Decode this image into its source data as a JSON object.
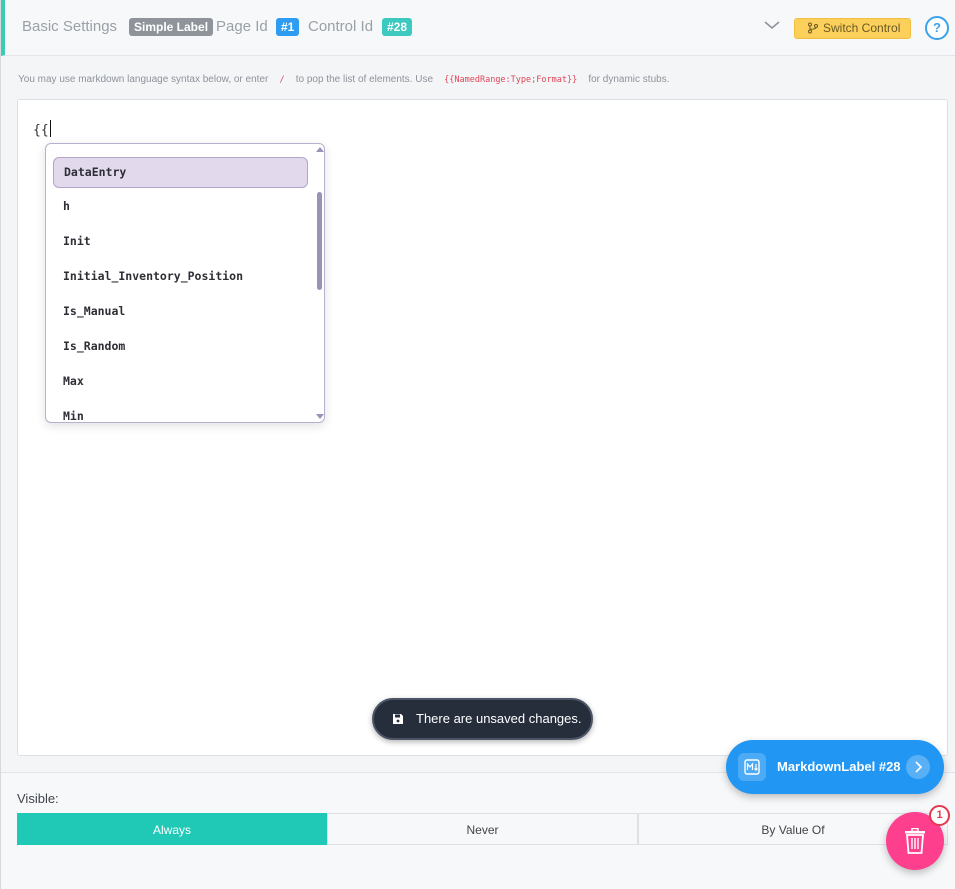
{
  "header": {
    "basic_settings": "Basic Settings",
    "type_badge": "Simple Label",
    "page_id_label": "Page Id",
    "page_id": "#1",
    "control_id_label": "Control Id",
    "control_id": "#28",
    "switch_control": "Switch Control",
    "help": "?"
  },
  "hint": {
    "part1": "You may use markdown language syntax below, or enter",
    "slash": "/",
    "part2": "to pop the list of elements. Use",
    "stub": "{{NamedRange:Type;Format}}",
    "part3": "for dynamic stubs."
  },
  "editor": {
    "value": "{{"
  },
  "dropdown": {
    "items": [
      "DataEntry",
      "h",
      "Init",
      "Initial_Inventory_Position",
      "Is_Manual",
      "Is_Random",
      "Max",
      "Min"
    ],
    "selected_index": 0
  },
  "toast": {
    "message": "There are unsaved changes."
  },
  "visibility": {
    "label": "Visible:",
    "options": [
      "Always",
      "Never",
      "By Value Of"
    ],
    "selected": "Always"
  },
  "control_chip": {
    "label": "MarkdownLabel #28"
  },
  "trash": {
    "count": "1"
  },
  "colors": {
    "accent_teal": "#20c9b6",
    "badge_grey": "#8f949b",
    "badge_blue": "#2e9cf0",
    "badge_teal": "#3cc9c0",
    "switch_yellow": "#fcd05a",
    "chip_blue": "#2196f3",
    "trash_pink": "#fe3f8e"
  }
}
